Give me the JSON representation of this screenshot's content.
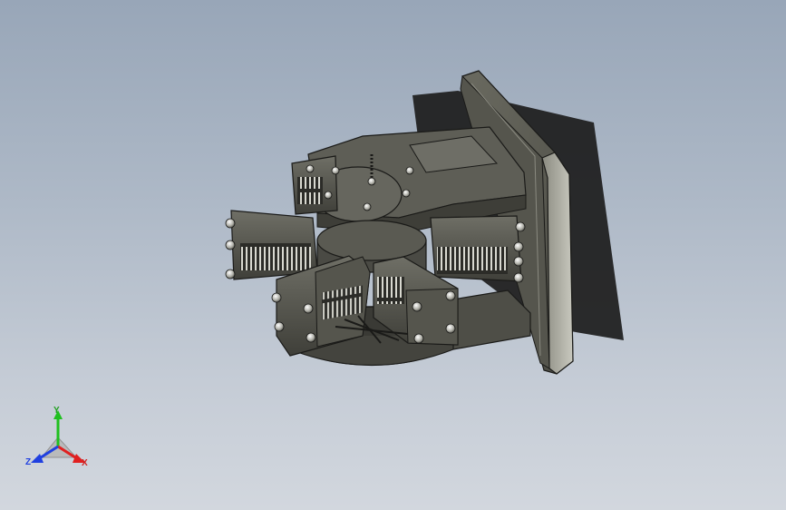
{
  "viewport": {
    "background_top": "#98a6b8",
    "background_bottom": "#d2d7de"
  },
  "model": {
    "description_icon": "cad-3d-model",
    "body_color": "#5a5a52",
    "shadow_color": "#1e1e1e"
  },
  "triad": {
    "x_label": "X",
    "y_label": "Y",
    "z_label": "Z",
    "x_color": "#e02020",
    "y_color": "#20c020",
    "z_color": "#2040e0"
  }
}
